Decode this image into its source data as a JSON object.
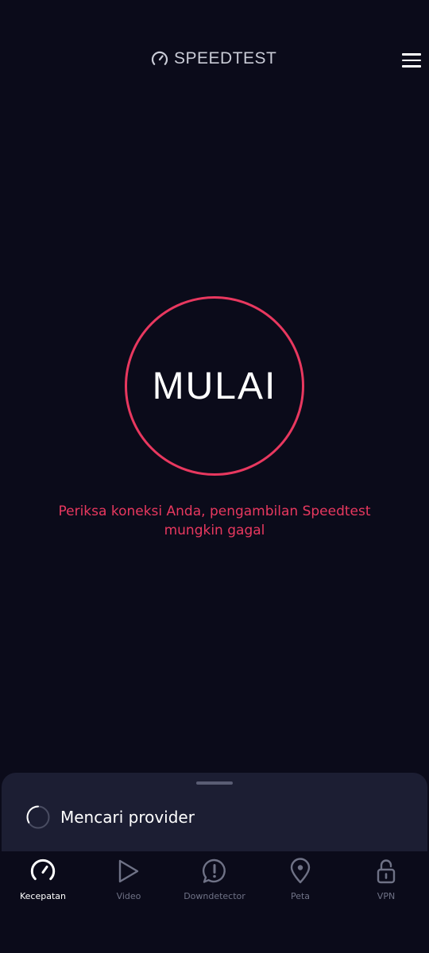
{
  "header": {
    "brand_text": "SPEEDTEST",
    "brand_icon": "speedometer-icon",
    "menu_icon": "hamburger-menu-icon"
  },
  "main": {
    "start_label": "MULAI",
    "warning_line1": "Periksa koneksi Anda, pengambilan Speedtest",
    "warning_line2": "mungkin gagal"
  },
  "sheet": {
    "provider_text": "Mencari provider",
    "spinner_icon": "loading-spinner-icon"
  },
  "nav": {
    "items": [
      {
        "label": "Kecepatan",
        "icon": "speed-gauge-icon",
        "active": true
      },
      {
        "label": "Video",
        "icon": "play-icon",
        "active": false
      },
      {
        "label": "Downdetector",
        "icon": "alert-bubble-icon",
        "active": false
      },
      {
        "label": "Peta",
        "icon": "map-pin-icon",
        "active": false
      },
      {
        "label": "VPN",
        "icon": "unlock-icon",
        "active": false
      }
    ]
  },
  "colors": {
    "background": "#0b0b1a",
    "accent": "#e8385f",
    "sheet": "#1c1e33",
    "inactive": "#6f7286"
  }
}
